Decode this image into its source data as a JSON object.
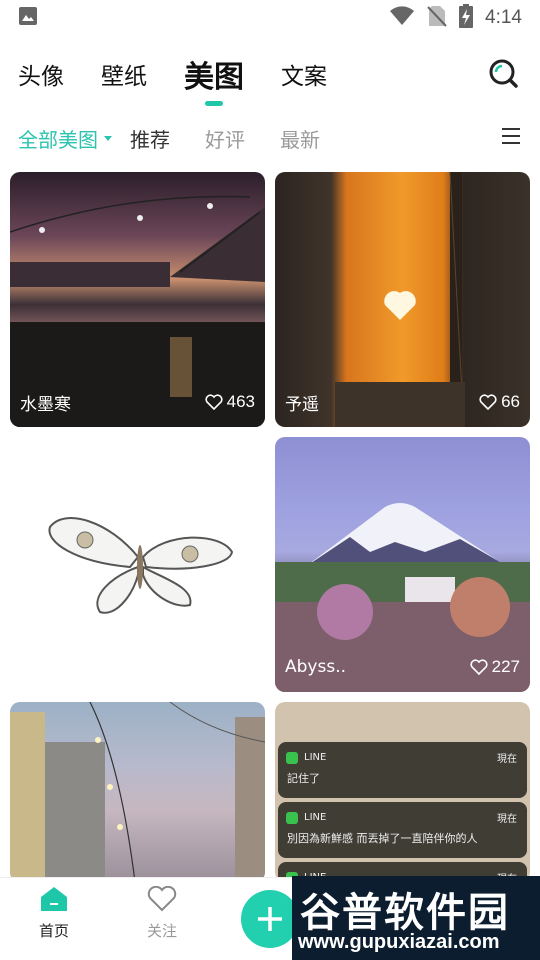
{
  "status_bar": {
    "time": "4:14",
    "icons": [
      "image-icon",
      "wifi-icon",
      "no-sim-icon",
      "battery-charging-icon"
    ]
  },
  "top_tabs": [
    {
      "label": "头像",
      "active": false
    },
    {
      "label": "壁纸",
      "active": false
    },
    {
      "label": "美图",
      "active": true
    },
    {
      "label": "文案",
      "active": false
    }
  ],
  "header": {
    "search_icon": "search-icon"
  },
  "filters": [
    {
      "label": "全部美图",
      "active": true
    },
    {
      "label": "推荐",
      "active": false
    },
    {
      "label": "好评",
      "active": false
    },
    {
      "label": "最新",
      "active": false
    }
  ],
  "feed": {
    "cards": [
      {
        "user": "水墨寒",
        "likes": "463"
      },
      {
        "user": "予遥",
        "likes": "66"
      },
      {
        "user": "",
        "likes": ""
      },
      {
        "user": "Abyss..",
        "likes": "227"
      }
    ],
    "notifications": [
      {
        "app": "LINE",
        "time": "現在",
        "text": "記住了"
      },
      {
        "app": "LINE",
        "time": "現在",
        "text": "別因為新鮮感 而丟掉了一直陪伴你的人"
      },
      {
        "app": "LINE",
        "time": "現在",
        "text": ""
      }
    ]
  },
  "bottom_nav": {
    "home_label": "首页",
    "follow_label": "关注",
    "add_icon": "plus-icon"
  },
  "watermark": {
    "title": "谷普软件园",
    "url": "www.gupuxiazai.com"
  },
  "colors": {
    "accent": "#1fc7a9",
    "fab": "#22cfae"
  }
}
